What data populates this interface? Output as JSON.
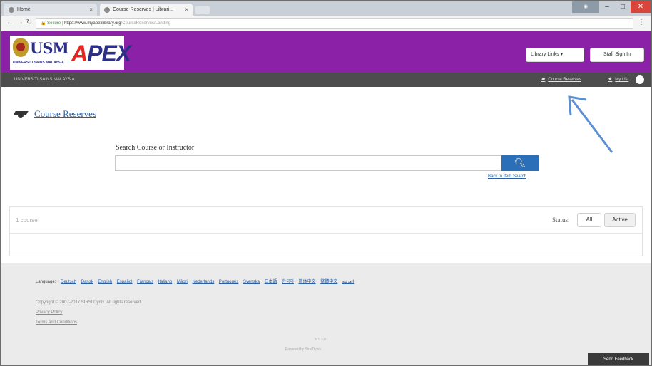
{
  "browser": {
    "tabs": [
      {
        "label": "Home"
      },
      {
        "label": "Course Reserves | Librari..."
      }
    ],
    "url_secure": "Secure",
    "url_host": "https://www.myapexlibrary.org",
    "url_path": "/CourseReserves/Landing"
  },
  "header": {
    "logo_usm": "USM",
    "logo_usm_sub": "UNIVERSITI SAINS MALAYSIA",
    "logo_apex_a": "A",
    "logo_apex_rest": "PEX",
    "library_links": "Library Links ▾",
    "staff_sign_in": "Staff Sign In"
  },
  "subbar": {
    "university": "UNIVERSITI SAINS MALAYSIA",
    "course_reserves": "Course Reserves",
    "my_list": "My List"
  },
  "main": {
    "title": "Course Reserves",
    "search_label": "Search Course or Instructor",
    "search_placeholder": "",
    "back_link": "Back to Item Search",
    "results_count": "1 course",
    "status_label": "Status:",
    "status_all": "All",
    "status_active": "Active"
  },
  "footer": {
    "language_label": "Language:",
    "languages": [
      "Deutsch",
      "Dansk",
      "English",
      "Español",
      "Français",
      "Italiano",
      "Māori",
      "Nederlands",
      "Português",
      "Svenska",
      "日本語",
      "한국어",
      "简体中文",
      "繁體中文",
      "العربية"
    ],
    "copyright": "Copyright © 2007-2017 SIRSI Dynix. All rights reserved.",
    "privacy": "Privacy Policy",
    "terms": "Terms and Conditions",
    "version": "v.1.3.0",
    "powered": "Powered by SirsiDynix",
    "feedback": "Send Feedback"
  }
}
